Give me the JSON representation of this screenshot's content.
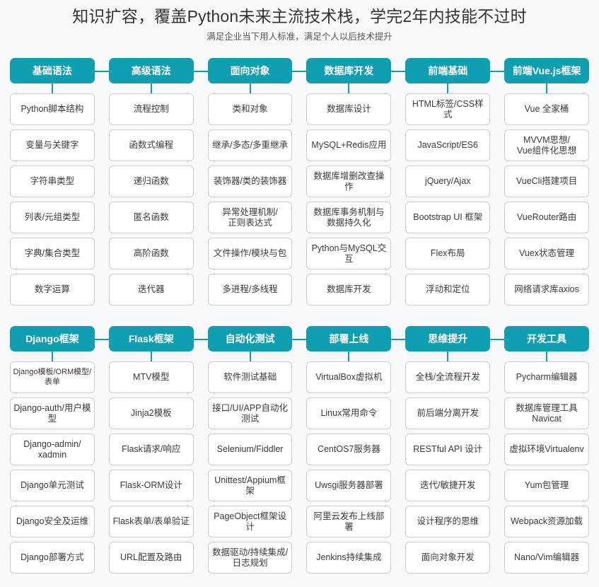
{
  "header": {
    "title": "知识扩容，覆盖Python未来主流技术栈，学完2年内技能不过时",
    "subtitle": "满足企业当下用人标准，满足个人以后技术提升"
  },
  "theme": {
    "accent": "#0f9fb0",
    "background": "#f7f9fa",
    "card_bg": "#ffffff",
    "card_border": "#cccccc",
    "header_text": "#ffffff",
    "body_text": "#3a3a3a"
  },
  "tables": [
    {
      "id": "table-upper",
      "columns": [
        {
          "header": "基础语法",
          "items": [
            "Python脚本结构",
            "变量与关键字",
            "字符串类型",
            "列表/元组类型",
            "字典/集合类型",
            "数字运算"
          ]
        },
        {
          "header": "高级语法",
          "items": [
            "流程控制",
            "函数式编程",
            "递归函数",
            "匿名函数",
            "高阶函数",
            "迭代器"
          ]
        },
        {
          "header": "面向对象",
          "items": [
            "类和对象",
            "继承/多态/多重继承",
            "装饰器/类的装饰器",
            "异常处理机制/\n正则表达式",
            "文件操作/模块与包",
            "多进程/多线程"
          ]
        },
        {
          "header": "数据库开发",
          "items": [
            "数据库设计",
            "MySQL+Redis应用",
            "数据库增删改查操作",
            "数据库事务机制与\n数据持久化",
            "Python与MySQL交互",
            "数据库开发"
          ]
        },
        {
          "header": "前端基础",
          "items": [
            "HTML标签/CSS样式",
            "JavaScript/ES6",
            "jQuery/Ajax",
            "Bootstrap UI 框架",
            "Flex布局",
            "浮动和定位"
          ]
        },
        {
          "header": "前端Vue.js框架",
          "items": [
            "Vue 全家桶",
            "MVVM思想/\nVue组件化思想",
            "VueCli搭建项目",
            "VueRouter路由",
            "Vuex状态管理",
            "网络请求库axios"
          ]
        }
      ]
    },
    {
      "id": "table-lower",
      "columns": [
        {
          "header": "Django框架",
          "items": [
            "Django模板/ORM模型/\n表单",
            "Django-auth/用户模型",
            "Django-admin/\nxadmin",
            "Django单元测试",
            "Django安全及运维",
            "Django部署方式"
          ]
        },
        {
          "header": "Flask框架",
          "items": [
            "MTV模型",
            "Jinja2模板",
            "Flask请求/响应",
            "Flask-ORM设计",
            "Flask表单/表单验证",
            "URL配置及路由"
          ]
        },
        {
          "header": "自动化测试",
          "items": [
            "软件测试基础",
            "接口/UI/APP自动化测试",
            "Selenium/Fiddler",
            "Unittest/Appium框架",
            "PageObject框架设计",
            "数据驱动/持续集成/\n日志规划"
          ]
        },
        {
          "header": "部署上线",
          "items": [
            "VirtualBox虚拟机",
            "Linux常用命令",
            "CentOS7服务器",
            "Uwsgi服务器部署",
            "阿里云发布上线部署",
            "Jenkins持续集成"
          ]
        },
        {
          "header": "思维提升",
          "items": [
            "全栈/全流程开发",
            "前后端分离开发",
            "RESTful API 设计",
            "迭代/敏捷开发",
            "设计程序的思维",
            "面向对象开发"
          ]
        },
        {
          "header": "开发工具",
          "items": [
            "Pycharm编辑器",
            "数据库管理工具\nNavicat",
            "虚拟环境Virtualenv",
            "Yum包管理",
            "Webpack资源加载",
            "Nano/Vim编辑器"
          ]
        }
      ]
    }
  ]
}
